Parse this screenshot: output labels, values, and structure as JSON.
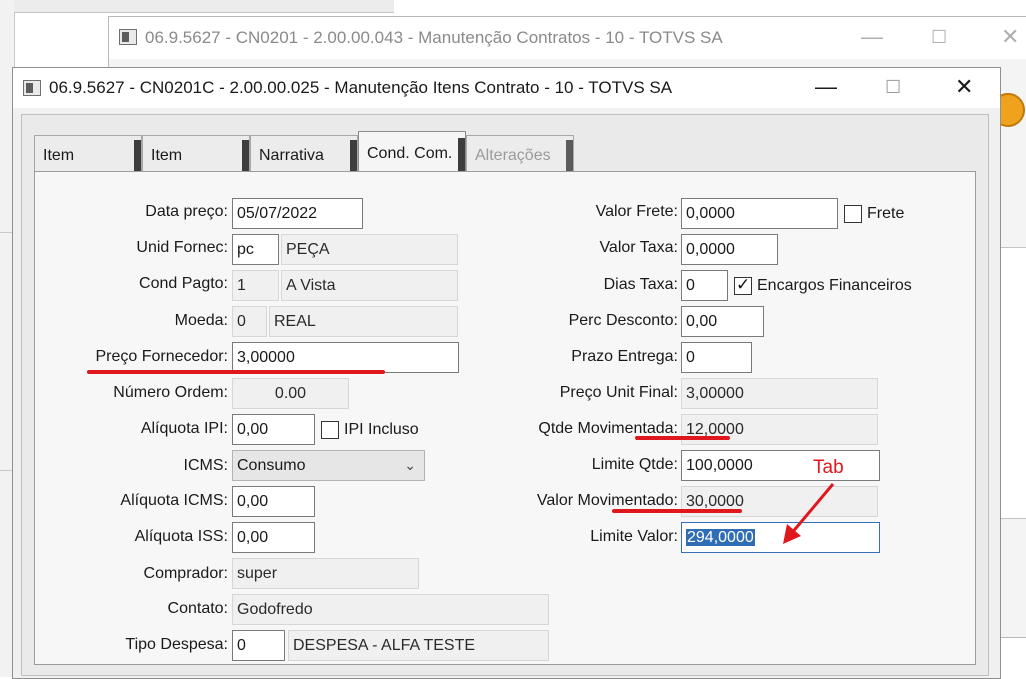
{
  "back_window": {
    "title": "06.9.5627 - CN0201 - 2.00.00.043 - Manutenção Contratos - 10 - TOTVS SA",
    "controls": {
      "minimize": "—",
      "maximize": "☐",
      "close": "✕"
    }
  },
  "front_window": {
    "title": "06.9.5627 - CN0201C - 2.00.00.025 - Manutenção Itens Contrato - 10 - TOTVS SA",
    "controls": {
      "minimize": "—",
      "maximize": "☐",
      "close": "✕"
    }
  },
  "tabs": [
    {
      "label": "Item",
      "state": "normal"
    },
    {
      "label": "Item",
      "state": "normal"
    },
    {
      "label": "Narrativa",
      "state": "normal"
    },
    {
      "label": "Cond. Com.",
      "state": "active"
    },
    {
      "label": "Alterações",
      "state": "disabled"
    }
  ],
  "left_fields": {
    "data_preco": {
      "label": "Data preço:",
      "value": "05/07/2022"
    },
    "unid_fornec": {
      "label": "Unid Fornec:",
      "code": "pc",
      "desc": "PEÇA"
    },
    "cond_pagto": {
      "label": "Cond Pagto:",
      "code": "1",
      "desc": "A Vista"
    },
    "moeda": {
      "label": "Moeda:",
      "code": "0",
      "desc": "REAL"
    },
    "preco_fornecedor": {
      "label": "Preço Fornecedor:",
      "value": "3,00000"
    },
    "numero_ordem": {
      "label": "Número Ordem:",
      "value": "0.00"
    },
    "aliquota_ipi": {
      "label": "Alíquota IPI:",
      "value": "0,00",
      "checkbox_label": "IPI Incluso",
      "checked": false
    },
    "icms": {
      "label": "ICMS:",
      "value": "Consumo"
    },
    "aliquota_icms": {
      "label": "Alíquota ICMS:",
      "value": "0,00"
    },
    "aliquota_iss": {
      "label": "Alíquota ISS:",
      "value": "0,00"
    },
    "comprador": {
      "label": "Comprador:",
      "value": "super"
    },
    "contato": {
      "label": "Contato:",
      "value": "Godofredo"
    },
    "tipo_despesa": {
      "label": "Tipo Despesa:",
      "code": "0",
      "desc": "DESPESA - ALFA TESTE"
    }
  },
  "right_fields": {
    "valor_frete": {
      "label": "Valor Frete:",
      "value": "0,0000",
      "checkbox_label": "Frete",
      "checked": false
    },
    "valor_taxa": {
      "label": "Valor Taxa:",
      "value": "0,0000"
    },
    "dias_taxa": {
      "label": "Dias Taxa:",
      "value": "0",
      "checkbox_label": "Encargos Financeiros",
      "checked": true
    },
    "perc_desconto": {
      "label": "Perc Desconto:",
      "value": "0,00"
    },
    "prazo_entrega": {
      "label": "Prazo Entrega:",
      "value": "0"
    },
    "preco_unit_final": {
      "label": "Preço Unit Final:",
      "value": "3,00000"
    },
    "qtde_movimentada": {
      "label": "Qtde Movimentada:",
      "value": "12,0000"
    },
    "limite_qtde": {
      "label": "Limite Qtde:",
      "value": "100,0000"
    },
    "valor_movimentado": {
      "label": "Valor Movimentado:",
      "value": "30,0000"
    },
    "limite_valor": {
      "label": "Limite Valor:",
      "value": "294,0000"
    }
  },
  "annotations": {
    "tab_note": "Tab",
    "color": "#e0181e"
  },
  "colors": {
    "selection": "#2f6db5",
    "focus_border": "#3a6fb8",
    "accent_orange": "#f0a21e"
  },
  "icons": {
    "window": "window-icon",
    "dropdown": "chevron-down-icon",
    "annotation_arrow": "arrow-icon"
  }
}
